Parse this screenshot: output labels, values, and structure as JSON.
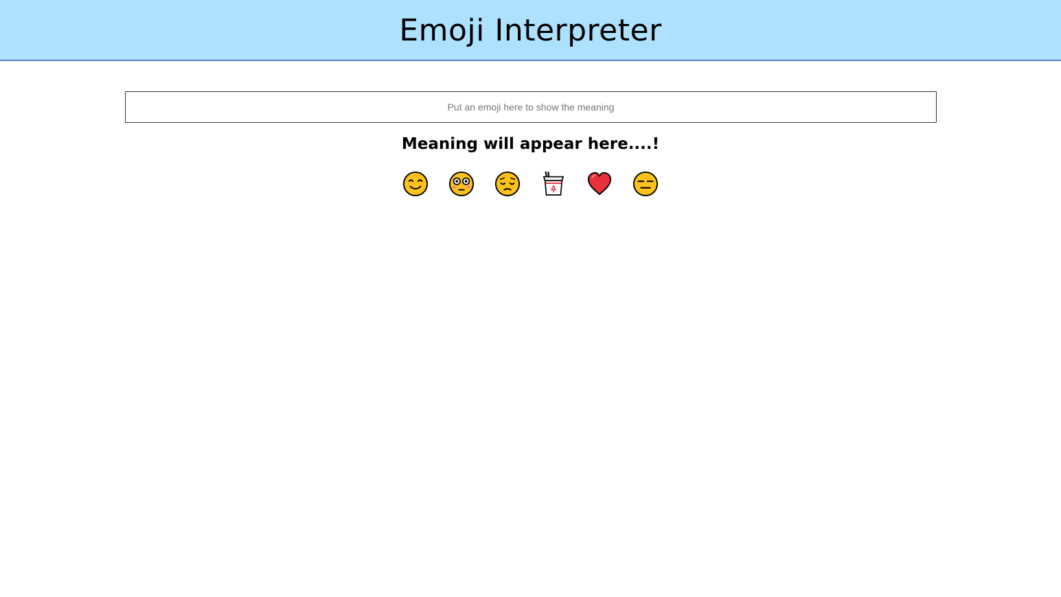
{
  "header": {
    "title": "Emoji Interpreter",
    "background_color": "#aee1fd",
    "border_color": "#5b82c9"
  },
  "search": {
    "placeholder": "Put an emoji here to show the meaning",
    "value": ""
  },
  "output": {
    "meaning_text": "Meaning will appear here....!"
  },
  "emojis": [
    {
      "icon": "smiling-face-with-smiling-eyes-icon",
      "color": "#fcc21b"
    },
    {
      "icon": "flushed-face-icon",
      "color": "#fcc21b"
    },
    {
      "icon": "pensive-face-icon",
      "color": "#fcc21b"
    },
    {
      "icon": "takeout-box-icon",
      "color": "#e8313a"
    },
    {
      "icon": "red-heart-icon",
      "color": "#e8313a"
    },
    {
      "icon": "expressionless-face-icon",
      "color": "#fcc21b"
    }
  ]
}
